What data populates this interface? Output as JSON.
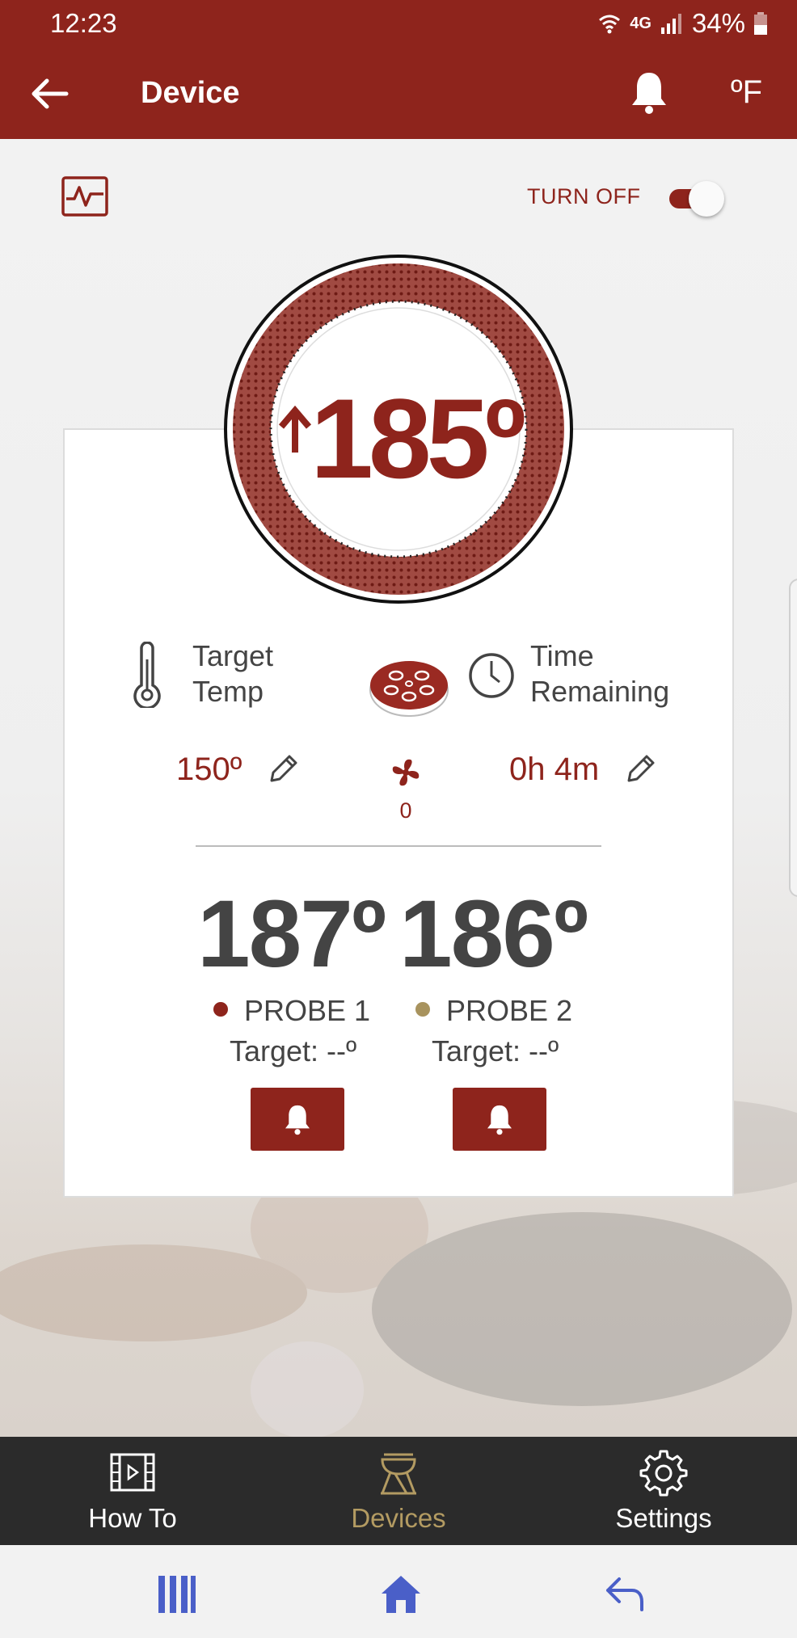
{
  "status_bar": {
    "time": "12:23",
    "network": "4G",
    "battery": "34%"
  },
  "app_bar": {
    "title": "Device",
    "unit": "ºF"
  },
  "controls": {
    "power_label": "TURN OFF",
    "power_on": true
  },
  "dial": {
    "temperature": "185º",
    "trend": "up"
  },
  "target": {
    "label_line1": "Target",
    "label_line2": "Temp",
    "value": "150º"
  },
  "time": {
    "label_line1": "Time",
    "label_line2": "Remaining",
    "value": "0h 4m"
  },
  "fan": {
    "count": "0"
  },
  "probes": [
    {
      "temp": "187º",
      "name": "PROBE 1",
      "target": "Target: --º",
      "color": "#8e241c"
    },
    {
      "temp": "186º",
      "name": "PROBE 2",
      "target": "Target: --º",
      "color": "#a8935e"
    }
  ],
  "bottom_nav": {
    "items": [
      {
        "label": "How To",
        "icon": "video-icon",
        "active": false
      },
      {
        "label": "Devices",
        "icon": "grill-icon",
        "active": true
      },
      {
        "label": "Settings",
        "icon": "gear-icon",
        "active": false
      }
    ]
  },
  "colors": {
    "brand": "#8e241c",
    "active_nav": "#b39b62",
    "nav_bg": "#2b2b2b"
  }
}
